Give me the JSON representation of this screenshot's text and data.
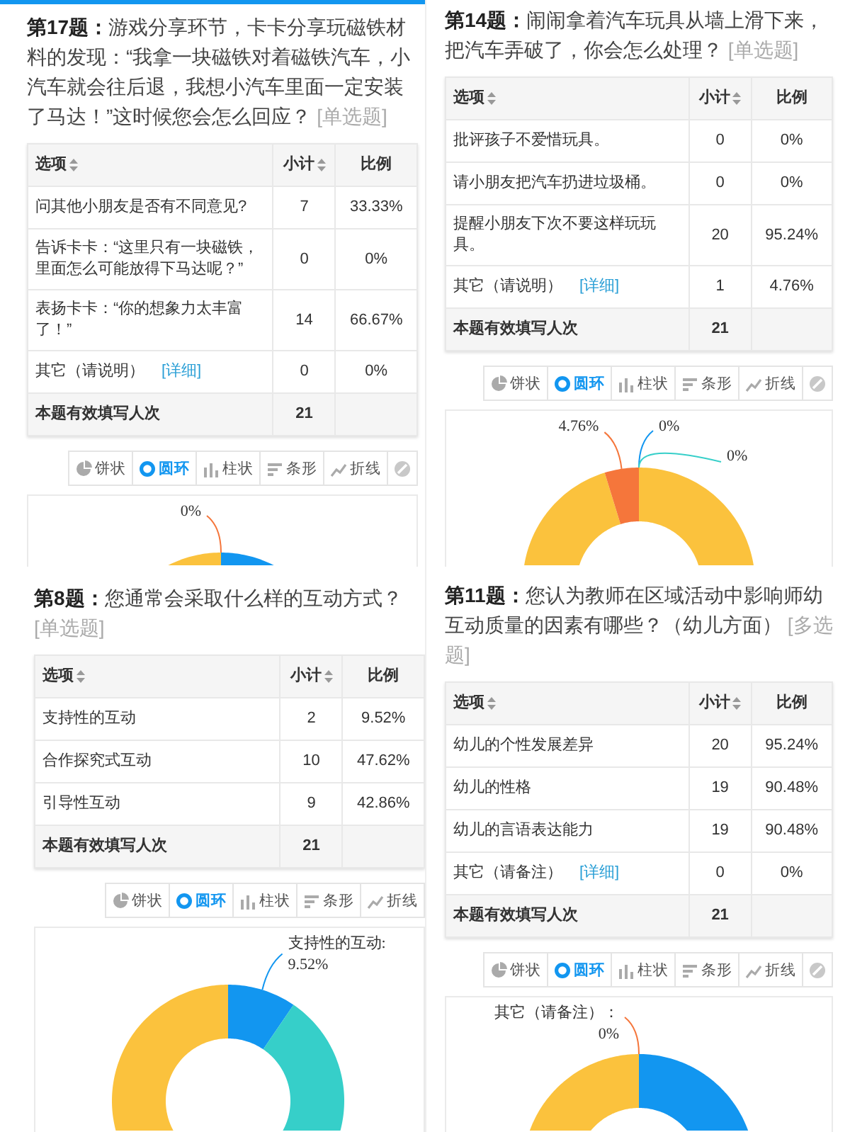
{
  "panels": [
    {
      "question": "**第17题：**游戏分享环节，卡卡分享玩磁铁材料的发现：“我拿一块磁铁对着磁铁汽车，小汽车就会往后退，我想小汽车里面一定安装了马达！”这时候您会怎么回应？",
      "type_tag": "[单选题]",
      "table": {
        "columns": [
          "选项",
          "小计",
          "比例"
        ],
        "sortable": [
          true,
          true,
          false
        ],
        "rows": [
          {
            "option": "问其他小朋友是否有不同意见?",
            "count": "7",
            "ratio": "33.33%"
          },
          {
            "option": "告诉卡卡：“这里只有一块磁铁，里面怎么可能放得下马达呢？”",
            "count": "0",
            "ratio": "0%"
          },
          {
            "option": "表扬卡卡：“你的想象力太丰富了！”",
            "count": "14",
            "ratio": "66.67%"
          },
          {
            "option": "其它（请说明）",
            "detail_link": "[详细]",
            "count": "0",
            "ratio": "0%"
          }
        ],
        "total": {
          "label": "本题有效填写人次",
          "count": "21"
        }
      },
      "chart_labels": [
        {
          "kind": "end",
          "lines": [
            "0%"
          ]
        }
      ],
      "toolbar": [
        {
          "kind": "pie",
          "label": "饼状",
          "selected": false
        },
        {
          "kind": "donut",
          "label": "圆环",
          "selected": true
        },
        {
          "kind": "column",
          "label": "柱状",
          "selected": false
        },
        {
          "kind": "bar",
          "label": "条形",
          "selected": false
        },
        {
          "kind": "line",
          "label": "折线",
          "selected": false
        },
        {
          "kind": "clear",
          "selected": false
        }
      ]
    },
    {
      "question": "**第14题：**闹闹拿着汽车玩具从墙上滑下来，把汽车弄破了，你会怎么处理？",
      "type_tag": "[单选题]",
      "table": {
        "columns": [
          "选项",
          "小计",
          "比例"
        ],
        "sortable": [
          true,
          true,
          false
        ],
        "rows": [
          {
            "option": "批评孩子不爱惜玩具。",
            "count": "0",
            "ratio": "0%"
          },
          {
            "option": "请小朋友把汽车扔进垃圾桶。",
            "count": "0",
            "ratio": "0%"
          },
          {
            "option": "提醒小朋友下次不要这样玩玩具。",
            "count": "20",
            "ratio": "95.24%"
          },
          {
            "option": "其它（请说明）",
            "detail_link": "[详细]",
            "count": "1",
            "ratio": "4.76%"
          }
        ],
        "total": {
          "label": "本题有效填写人次",
          "count": "21"
        }
      },
      "chart_labels": [
        {
          "kind": "end",
          "lines": [
            "4.76%"
          ]
        },
        {
          "kind": "start",
          "lines": [
            "0%"
          ]
        },
        {
          "kind": "start",
          "lines": [
            "0%"
          ]
        }
      ],
      "toolbar": [
        {
          "kind": "pie",
          "label": "饼状",
          "selected": false
        },
        {
          "kind": "donut",
          "label": "圆环",
          "selected": true
        },
        {
          "kind": "column",
          "label": "柱状",
          "selected": false
        },
        {
          "kind": "bar",
          "label": "条形",
          "selected": false
        },
        {
          "kind": "line",
          "label": "折线",
          "selected": false
        },
        {
          "kind": "clear",
          "selected": false
        }
      ]
    },
    {
      "question": "**第8题：**您通常会采取什么样的互动方式？",
      "type_tag": "[单选题]",
      "table": {
        "columns": [
          "选项",
          "小计",
          "比例"
        ],
        "sortable": [
          true,
          true,
          false
        ],
        "rows": [
          {
            "option": "支持性的互动",
            "count": "2",
            "ratio": "9.52%"
          },
          {
            "option": "合作探究式互动",
            "count": "10",
            "ratio": "47.62%"
          },
          {
            "option": "引导性互动",
            "count": "9",
            "ratio": "42.86%"
          }
        ],
        "total": {
          "label": "本题有效填写人次",
          "count": "21"
        }
      },
      "chart_labels": [
        {
          "kind": "start",
          "lines": [
            "支持性的互动:",
            "9.52%"
          ]
        }
      ],
      "toolbar": [
        {
          "kind": "pie",
          "label": "饼状",
          "selected": false
        },
        {
          "kind": "donut",
          "label": "圆环",
          "selected": true
        },
        {
          "kind": "column",
          "label": "柱状",
          "selected": false
        },
        {
          "kind": "bar",
          "label": "条形",
          "selected": false
        },
        {
          "kind": "line",
          "label": "折线",
          "selected": false
        }
      ]
    },
    {
      "question": "**第11题：**您认为教师在区域活动中影响师幼互动质量的因素有哪些？（幼儿方面）",
      "type_tag": "[多选题]",
      "table": {
        "columns": [
          "选项",
          "小计",
          "比例"
        ],
        "sortable": [
          true,
          true,
          false
        ],
        "rows": [
          {
            "option": "幼儿的个性发展差异",
            "count": "20",
            "ratio": "95.24%"
          },
          {
            "option": "幼儿的性格",
            "count": "19",
            "ratio": "90.48%"
          },
          {
            "option": "幼儿的言语表达能力",
            "count": "19",
            "ratio": "90.48%"
          },
          {
            "option": "其它（请备注）",
            "detail_link": "[详细]",
            "count": "0",
            "ratio": "0%"
          }
        ],
        "total": {
          "label": "本题有效填写人次",
          "count": "21"
        }
      },
      "chart_labels": [
        {
          "kind": "end",
          "lines": [
            "其它（请备注）：",
            "0%"
          ]
        }
      ],
      "toolbar": [
        {
          "kind": "pie",
          "label": "饼状",
          "selected": false
        },
        {
          "kind": "donut",
          "label": "圆环",
          "selected": true
        },
        {
          "kind": "column",
          "label": "柱状",
          "selected": false
        },
        {
          "kind": "bar",
          "label": "条形",
          "selected": false
        },
        {
          "kind": "line",
          "label": "折线",
          "selected": false
        },
        {
          "kind": "clear",
          "selected": false
        }
      ]
    }
  ]
}
